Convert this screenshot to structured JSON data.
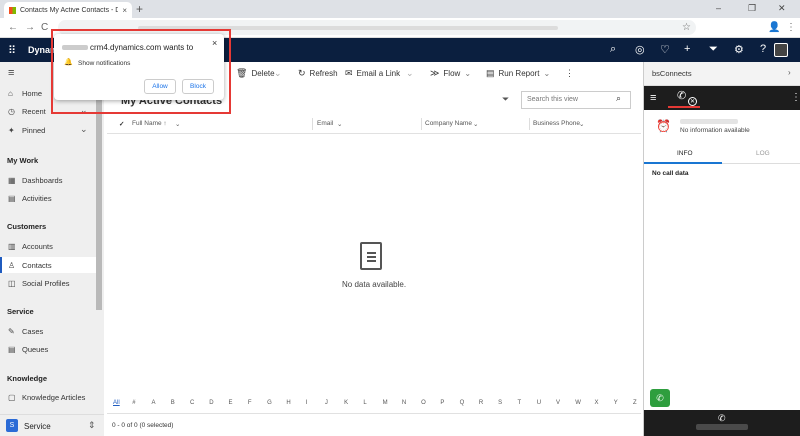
{
  "browser": {
    "tab_title": "Contacts My Active Contacts - D",
    "tab_close": "×",
    "new_tab": "+",
    "win_min": "–",
    "win_restore": "❐",
    "win_close": "✕",
    "back": "←",
    "forward": "→",
    "reload": "C",
    "star": "☆",
    "profile": "👤",
    "menu": "⋮"
  },
  "popup": {
    "title": "crm4.dynamics.com wants to",
    "permission": "Show notifications",
    "allow": "Allow",
    "block": "Block",
    "close": "×"
  },
  "topbar": {
    "app_title": "Dynam",
    "waffle": "⠿",
    "icons": {
      "search": "⌕",
      "assistant": "◎",
      "lightbulb": "♡",
      "new": "+",
      "filter": "⏷",
      "settings": "⚙",
      "help": "?"
    }
  },
  "sidebar": {
    "menu": "≡",
    "top": [
      {
        "label": "Home",
        "icon": "⌂"
      },
      {
        "label": "Recent",
        "icon": "◷",
        "chevron": "⌄"
      },
      {
        "label": "Pinned",
        "icon": "✦",
        "chevron": "⌄"
      }
    ],
    "groups": [
      {
        "title": "My Work",
        "items": [
          {
            "label": "Dashboards",
            "icon": "▦"
          },
          {
            "label": "Activities",
            "icon": "▤"
          }
        ]
      },
      {
        "title": "Customers",
        "items": [
          {
            "label": "Accounts",
            "icon": "▥"
          },
          {
            "label": "Contacts",
            "icon": "♙"
          },
          {
            "label": "Social Profiles",
            "icon": "◫"
          }
        ]
      },
      {
        "title": "Service",
        "items": [
          {
            "label": "Cases",
            "icon": "✎"
          },
          {
            "label": "Queues",
            "icon": "▤"
          }
        ]
      },
      {
        "title": "Knowledge",
        "items": [
          {
            "label": "Knowledge Articles",
            "icon": "▢"
          }
        ]
      }
    ],
    "area_badge": "S",
    "area": "Service",
    "area_switch": "⇕"
  },
  "commands": {
    "delete": "Delete",
    "refresh": "Refresh",
    "email_link": "Email a Link",
    "flow": "Flow",
    "run_report": "Run Report",
    "more": "⋮",
    "chev": "⌄"
  },
  "grid": {
    "view_title": "My Active Contacts",
    "search_placeholder": "Search this view",
    "search_icon": "⌕",
    "filter_icon": "⏷",
    "columns": [
      "Full Name ↑",
      "Email",
      "Company Name",
      "Business Phone"
    ],
    "check": "✓",
    "empty": "No data available.",
    "alphabet": [
      "All",
      "#",
      "A",
      "B",
      "C",
      "D",
      "E",
      "F",
      "G",
      "H",
      "I",
      "J",
      "K",
      "L",
      "M",
      "N",
      "O",
      "P",
      "Q",
      "R",
      "S",
      "T",
      "U",
      "V",
      "W",
      "X",
      "Y",
      "Z"
    ],
    "status": "0 - 0 of 0 (0 selected)"
  },
  "bsconnects": {
    "title": "bsConnects",
    "chevron": "›",
    "no_info": "No information available",
    "tab_info": "INFO",
    "tab_log": "LOG",
    "no_call": "No call data",
    "hamburger": "≡",
    "phone": "✆",
    "x": "✕",
    "dots": "⋮",
    "bell": "⏰"
  },
  "colors": {
    "nav": "#0b1f3f",
    "accent": "#1f5bbf",
    "highlight": "#e53935",
    "call": "#2e9e3e"
  }
}
